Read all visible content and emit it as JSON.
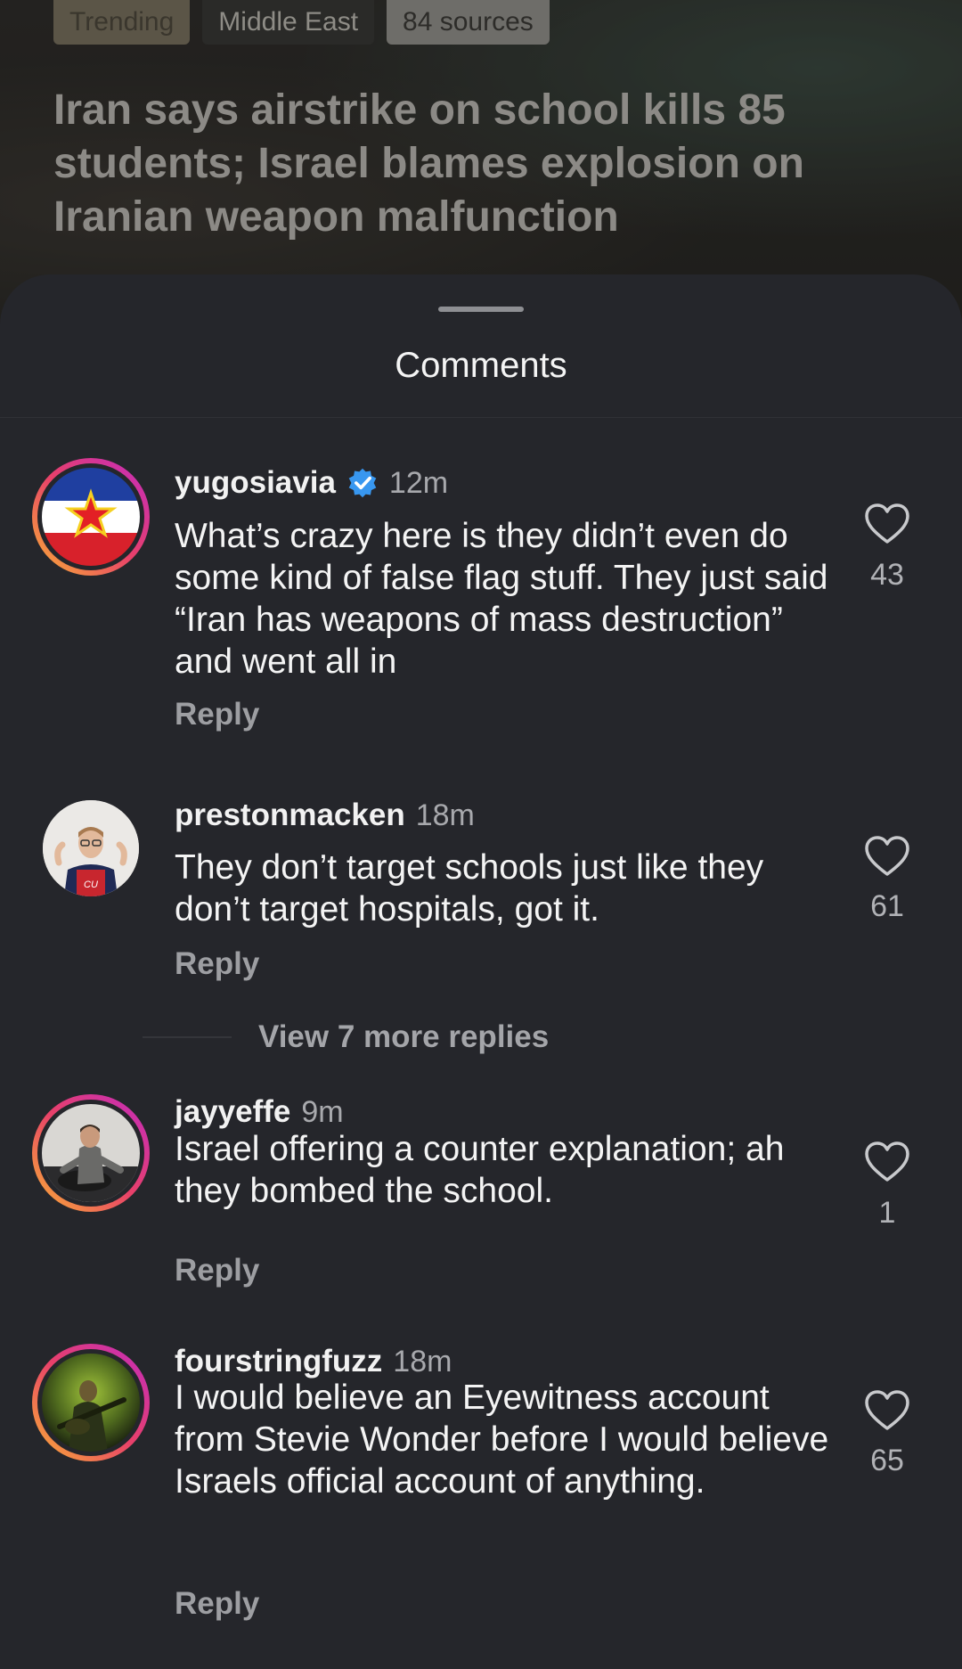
{
  "article": {
    "tags": [
      "Trending",
      "Middle East",
      "84 sources"
    ],
    "headline": "Iran says airstrike on school kills 85 students; Israel blames explosion on Iranian weapon malfunction"
  },
  "sheet": {
    "title": "Comments"
  },
  "comments": [
    {
      "username": "yugosiavia",
      "verified": true,
      "time": "12m",
      "text": "What’s crazy here is they didn’t even do some kind of false flag stuff. They just said “Iran has weapons of mass destruction” and went all in",
      "likes": "43",
      "reply_label": "Reply"
    },
    {
      "username": "prestonmacken",
      "verified": false,
      "time": "18m",
      "text": "They don’t target schools just like they don’t target hospitals, got it.",
      "likes": "61",
      "reply_label": "Reply",
      "view_replies": "View 7 more replies"
    },
    {
      "username": "jayyeffe",
      "verified": false,
      "time": "9m",
      "text": "Israel offering a counter explanation; ah they bombed the school.",
      "likes": "1",
      "reply_label": "Reply"
    },
    {
      "username": "fourstringfuzz",
      "verified": false,
      "time": "18m",
      "text": "I would believe an Eyewitness account from Stevie Wonder before I would believe Israels official account of anything.",
      "likes": "65",
      "reply_label": "Reply"
    }
  ],
  "colors": {
    "background": "#25262b",
    "verified_blue": "#3897f0",
    "ring_gradient": [
      "#f9b233",
      "#e8406a",
      "#c22bc0"
    ]
  },
  "icons": {
    "like": "heart-outline-icon",
    "verified": "verified-badge-icon"
  }
}
